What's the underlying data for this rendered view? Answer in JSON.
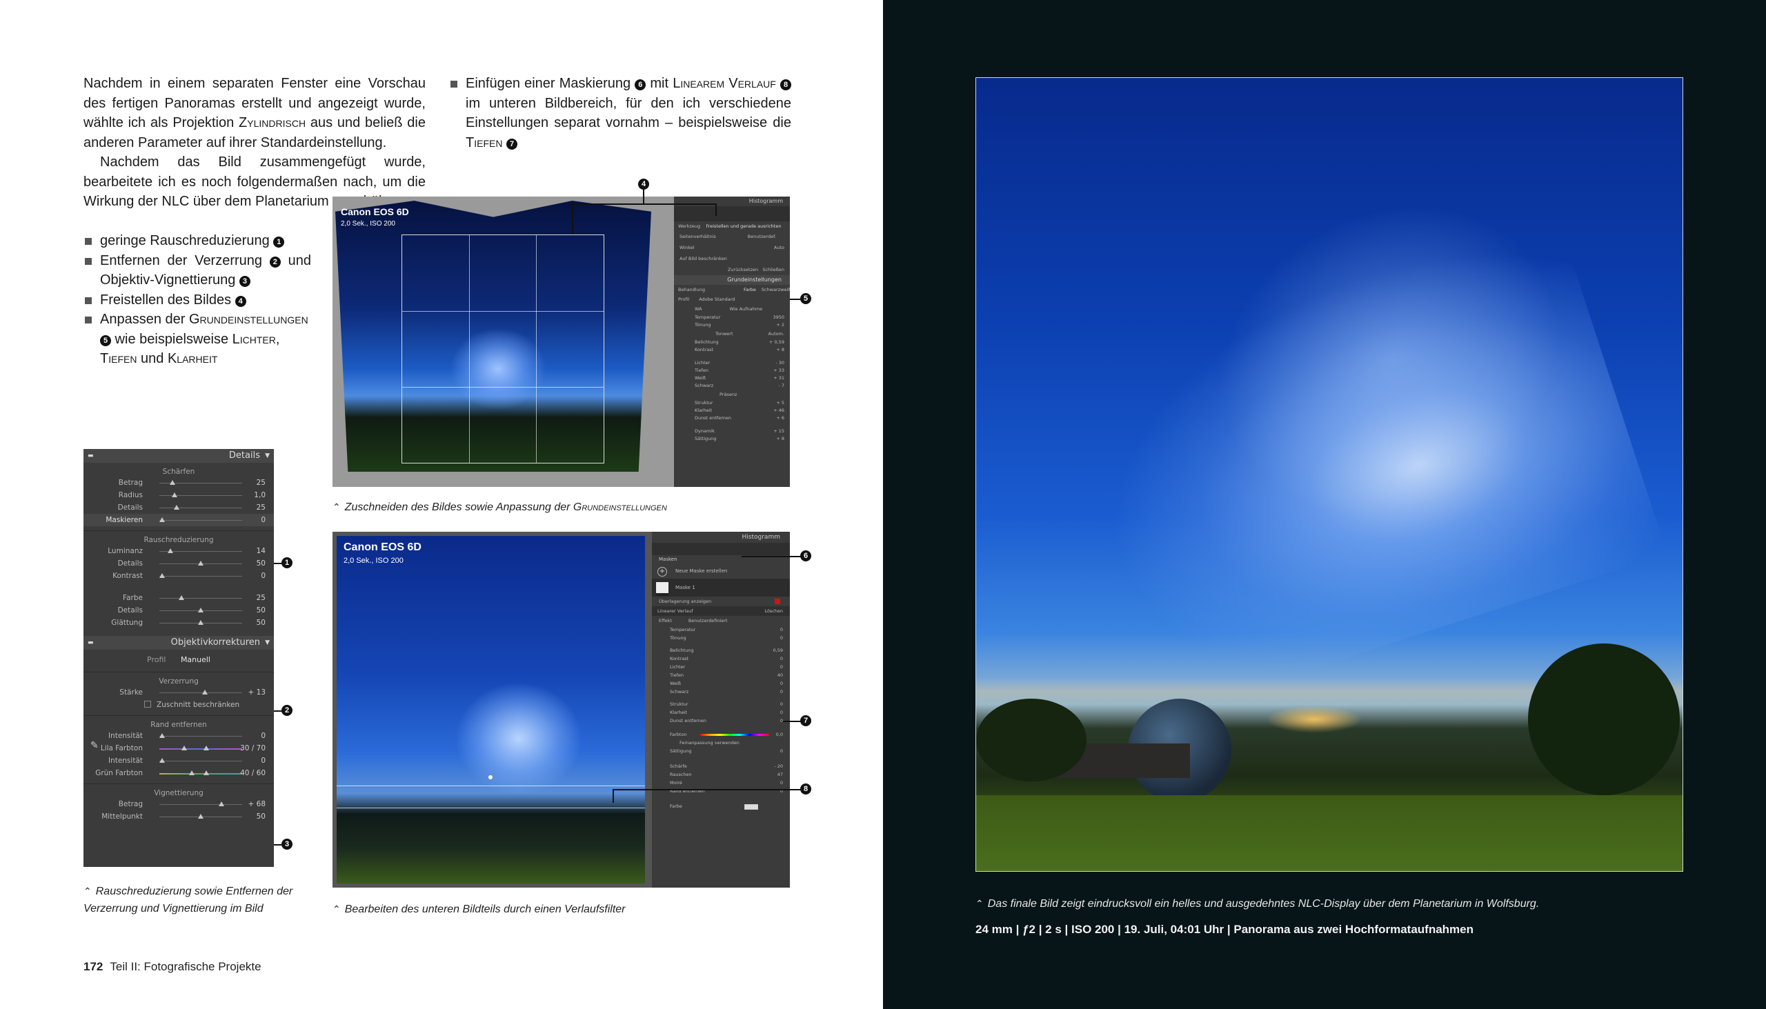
{
  "left_column": {
    "para1": "Nachdem in einem separaten Fenster eine Vorschau des fertigen Panoramas erstellt und angezeigt wurde, wählte ich als Projektion ",
    "para1_sc": "Zylindrisch",
    "para1_end": " aus und beließ die anderen Parameter auf ihrer Standardeinstellung.",
    "para2": "Nachdem das Bild zusammengefügt wurde, bearbeitete ich es noch folgendermaßen nach, um die Wirkung der NLC über dem Planetarium zu erhöhen:",
    "bullets": [
      {
        "text": "geringe Rauschreduzierung",
        "num": "1"
      },
      {
        "text": "Entfernen der Verzerrung",
        "num": "2",
        "text2": " und Objektiv-Vignettierung",
        "num2": "3"
      },
      {
        "text": "Freistellen des Bildes",
        "num": "4"
      }
    ],
    "bullet4_a": "Anpassen der ",
    "bullet4_sc": "Grundeinstellungen",
    "bullet4_num": "5",
    "bullet4_b": " wie beispielsweise ",
    "bullet4_sc2": "Lichter",
    "bullet4_c": ", ",
    "bullet4_sc3": "Tiefen",
    "bullet4_d": " und ",
    "bullet4_sc4": "Klarheit"
  },
  "right_column": {
    "a": "Einfügen einer Maskierung ",
    "num6": "6",
    "b": " mit ",
    "sc1": "Linearem Verlauf",
    "num8": "8",
    "c": " im unteren Bildbereich, für den ich verschiedene Einstellungen separat vornahm – beispielsweise die ",
    "sc2": "Tiefen",
    "num7": "7"
  },
  "details_panel": {
    "title": "Details",
    "sharpen_title": "Schärfen",
    "sharpen_rows": [
      {
        "label": "Betrag",
        "value": "25"
      },
      {
        "label": "Radius",
        "value": "1,0"
      },
      {
        "label": "Details",
        "value": "25"
      },
      {
        "label": "Maskieren",
        "value": "0"
      }
    ],
    "noise_title": "Rauschreduzierung",
    "noise_rows": [
      {
        "label": "Luminanz",
        "value": "14"
      },
      {
        "label": "Details",
        "value": "50"
      },
      {
        "label": "Kontrast",
        "value": "0"
      }
    ],
    "color_rows": [
      {
        "label": "Farbe",
        "value": "25"
      },
      {
        "label": "Details",
        "value": "50"
      },
      {
        "label": "Glättung",
        "value": "50"
      }
    ],
    "lens_title": "Objektivkorrekturen",
    "lens_tab_profile": "Profil",
    "lens_tab_manual": "Manuell",
    "distortion_title": "Verzerrung",
    "distortion_row": {
      "label": "Stärke",
      "value": "+ 13"
    },
    "constrain_label": "Zuschnitt beschränken",
    "fringe_title": "Rand entfernen",
    "fringe_rows": [
      {
        "label": "Intensität",
        "value": "0"
      },
      {
        "label": "Lila Farbton",
        "value": "30 / 70"
      },
      {
        "label": "Intensität",
        "value": "0"
      },
      {
        "label": "Grün Farbton",
        "value": "40 / 60"
      }
    ],
    "vignette_title": "Vignettierung",
    "vignette_rows": [
      {
        "label": "Betrag",
        "value": "+ 68"
      },
      {
        "label": "Mittelpunkt",
        "value": "50"
      }
    ]
  },
  "caption_left": "Rauschreduzierung sowie Entfernen der Verzerrung und Vignettierung im Bild",
  "shot1": {
    "camera": "Canon EOS 6D",
    "exposure": "2,0 Sek., ISO 200",
    "panel_title": "Histogramm",
    "panel_tabs": [
      "Werkzeug",
      "Freistellen und gerade ausrichten"
    ],
    "aspect_label": "Seitenverhältnis",
    "aspect_value": "Benutzerdef.",
    "angle_label": "Winkel",
    "auto_label": "Auto",
    "constrain_label": "Auf Bild beschränken",
    "reset_label": "Zurücksetzen",
    "close_label": "Schließen",
    "basic_title": "Grundeinstellungen",
    "treatment_label": "Behandlung",
    "treatment_color": "Farbe",
    "treatment_bw": "Schwarzweiß",
    "profile_label": "Profil",
    "profile_value": "Adobe Standard",
    "wb_label": "WA",
    "wb_value": "Wie Aufnahme",
    "temp_label": "Temperatur",
    "temp_value": "3950",
    "tint_label": "Tönung",
    "tint_value": "+ 2",
    "tone_label": "Tonwert",
    "auto2": "Autom.",
    "exposure_label": "Belichtung",
    "exposure_value": "+ 0,59",
    "contrast_label": "Kontrast",
    "contrast_value": "+ 8",
    "lights_label": "Lichter",
    "lights_value": "- 30",
    "depths_label": "Tiefen",
    "depths_value": "+ 33",
    "white_label": "Weiß",
    "white_value": "+ 31",
    "black_label": "Schwarz",
    "black_value": "- 7",
    "presence_label": "Präsenz",
    "texture_label": "Struktur",
    "texture_value": "+ 5",
    "clarity_label": "Klarheit",
    "clarity_value": "+ 46",
    "dehaze_label": "Dunst entfernen",
    "dehaze_value": "+ 6",
    "vibrance_label": "Dynamik",
    "vibrance_value": "+ 15",
    "saturation_label": "Sättigung",
    "saturation_value": "+ 8"
  },
  "caption_mid1_a": "Zuschneiden des Bildes sowie Anpassung der ",
  "caption_mid1_sc": "Grundeinstellungen",
  "shot2": {
    "camera": "Canon EOS 6D",
    "exposure": "2,0 Sek., ISO 200",
    "panel_title": "Histogramm",
    "masks_label": "Masken",
    "new_mask": "Neue Maske erstellen",
    "mask1": "Maske 1",
    "overlay_label": "Überlagerung anzeigen",
    "gradient_label": "Linearer Verlauf",
    "delete_label": "Löschen",
    "effect_label": "Effekt",
    "effect_value": "Benutzerdefiniert",
    "rows": [
      {
        "label": "Temperatur",
        "value": "0"
      },
      {
        "label": "Tönung",
        "value": "0"
      },
      {
        "label": "Belichtung",
        "value": "0,59"
      },
      {
        "label": "Kontrast",
        "value": "0"
      },
      {
        "label": "Lichter",
        "value": "0"
      },
      {
        "label": "Tiefen",
        "value": "40"
      },
      {
        "label": "Weiß",
        "value": "0"
      },
      {
        "label": "Schwarz",
        "value": "0"
      },
      {
        "label": "Struktur",
        "value": "0"
      },
      {
        "label": "Klarheit",
        "value": "0"
      },
      {
        "label": "Dunst entfernen",
        "value": "0"
      }
    ],
    "hue_label": "Farbton",
    "hue_value": "0,0",
    "fine_label": "Feinanpassung verwenden",
    "saturation_label": "Sättigung",
    "saturation_value": "0",
    "rows2": [
      {
        "label": "Schärfe",
        "value": "- 20"
      },
      {
        "label": "Rauschen",
        "value": "47"
      },
      {
        "label": "Moiré",
        "value": "0"
      },
      {
        "label": "Rand entfernen",
        "value": "0"
      }
    ],
    "color_label": "Farbe"
  },
  "caption_mid2": "Bearbeiten des unteren Bildteils durch einen Verlaufsfilter",
  "callouts": [
    "1",
    "2",
    "3",
    "4",
    "5",
    "6",
    "7",
    "8"
  ],
  "footer": {
    "page_number": "172",
    "part": "Teil II: Fotografische Projekte"
  },
  "right_page": {
    "caption": "Das finale Bild zeigt eindrucksvoll ein helles und ausgedehntes NLC-Display über dem Planetarium in Wolfsburg.",
    "exif": "24 mm | ƒ2 | 2 s | ISO 200 | 19. Juli, 04:01 Uhr | Panorama aus zwei Hochformataufnahmen"
  },
  "colors": {
    "dark_page": "#071418",
    "lr_panel": "#3b3b3b",
    "sky_blue": "#1d52b8"
  }
}
